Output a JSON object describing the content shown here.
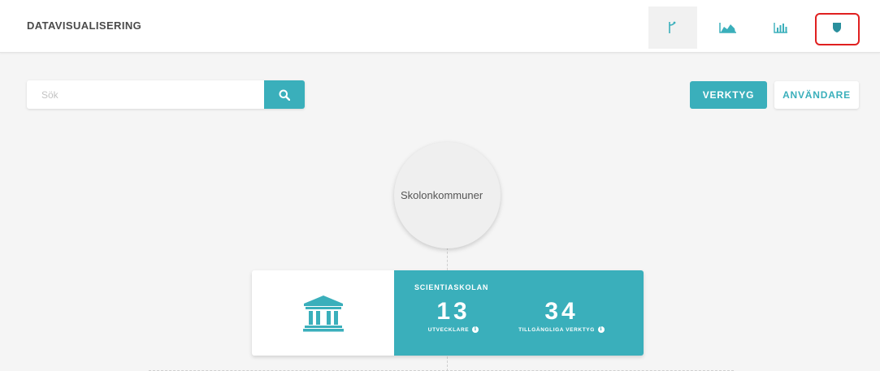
{
  "header": {
    "title": "DATAVISUALISERING",
    "tools": [
      {
        "name": "tree-icon",
        "active": true
      },
      {
        "name": "area-chart-icon",
        "active": false
      },
      {
        "name": "bar-chart-icon",
        "active": false
      },
      {
        "name": "shield-icon",
        "active": false,
        "highlighted": true
      }
    ]
  },
  "search": {
    "placeholder": "Sök",
    "value": ""
  },
  "view_toggle": {
    "verktyg_label": "VERKTYG",
    "anvandare_label": "ANVÄNDARE",
    "selected": "VERKTYG"
  },
  "tree": {
    "root_label": "Skolonkommuner",
    "school": {
      "name": "SCIENTIASKOLAN",
      "stats": [
        {
          "value": "13",
          "label": "UTVECKLARE"
        },
        {
          "value": "34",
          "label": "TILLGÄNGLIGA VERKTYG"
        }
      ]
    }
  },
  "colors": {
    "accent": "#3aafbb",
    "highlight": "#e02020",
    "background": "#f5f5f5"
  }
}
